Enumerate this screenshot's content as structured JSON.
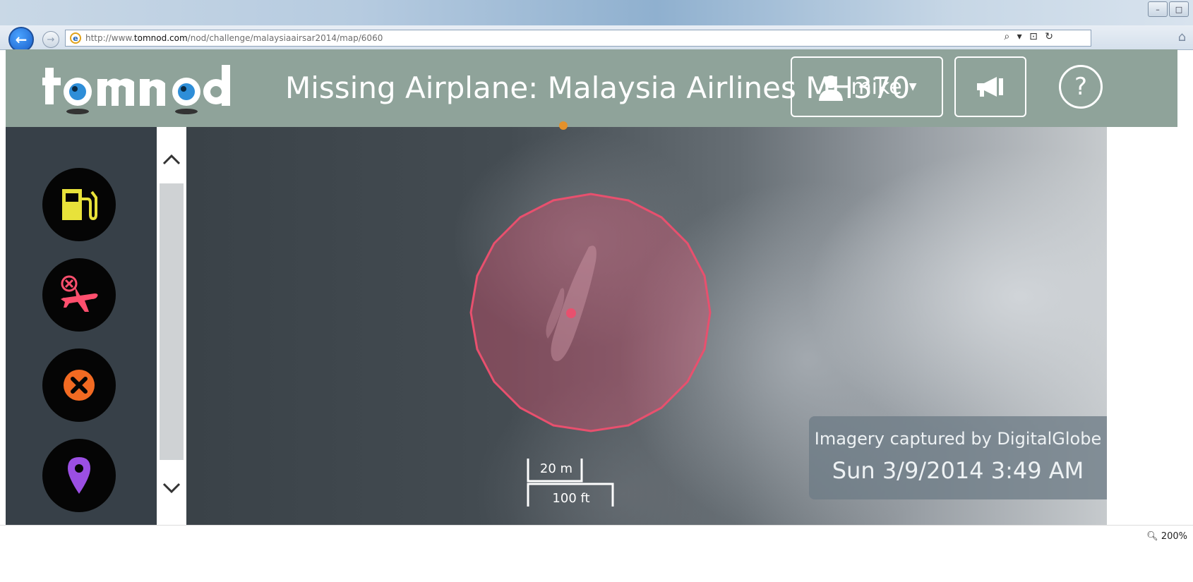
{
  "browser": {
    "url_prefix": "http://www.",
    "url_host": "tomnod.com",
    "url_path": "/nod/challenge/malaysiaairsar2014/map/6060",
    "tools_glyphs": "⌕ ▾ ⊡ ↻",
    "zoom_level": "200%"
  },
  "header": {
    "title": "Missing Airplane: Malaysia Airlines MH370",
    "user_name": "mike",
    "help_glyph": "?"
  },
  "tools": [
    {
      "name": "oil-slick",
      "icon": "fuel-pump-icon",
      "color": "#e8e23a"
    },
    {
      "name": "wreckage",
      "icon": "crashed-plane-icon",
      "color": "#ff4f6e"
    },
    {
      "name": "other",
      "icon": "x-circle-icon",
      "color": "#f26a22"
    },
    {
      "name": "marker",
      "icon": "map-pin-icon",
      "color": "#9b4fe3"
    }
  ],
  "map": {
    "scale_metric": "20 m",
    "scale_imperial": "100 ft",
    "imagery_credit": "Imagery captured by DigitalGlobe",
    "imagery_date": "Sun 3/9/2014 3:49 AM",
    "marker_color": "#e8506e"
  },
  "colors": {
    "header_bg": "#8fa39a",
    "panel_bg": "#374048",
    "tomnod_blue": "#2e8ed8"
  }
}
